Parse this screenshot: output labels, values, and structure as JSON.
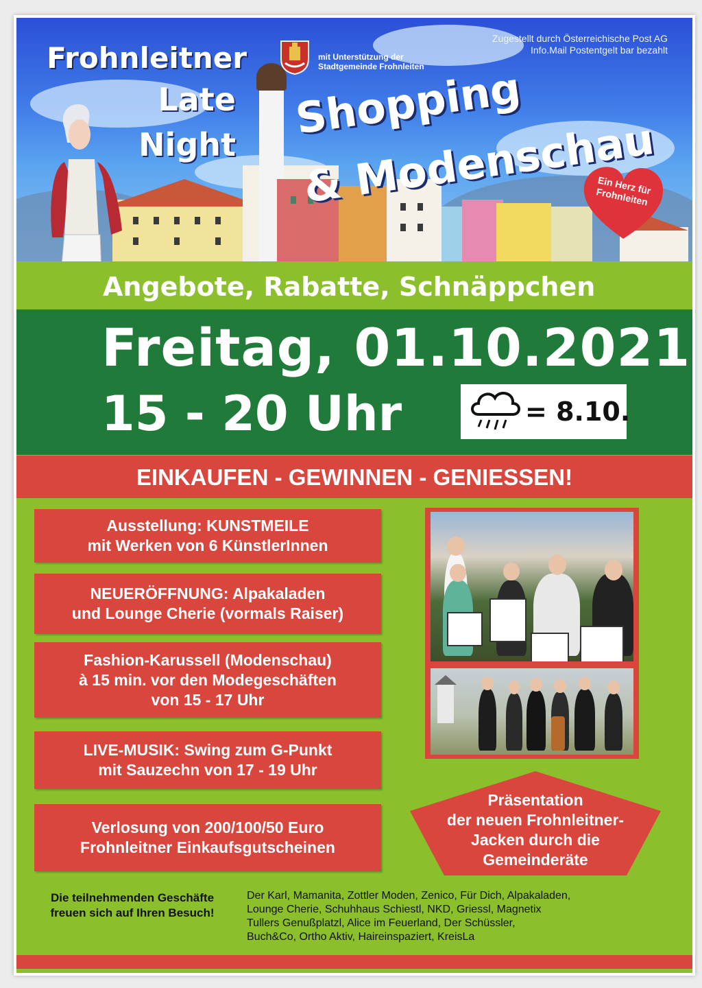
{
  "header": {
    "title_lines": [
      "Frohnleitner",
      "Late",
      "Night"
    ],
    "shopping": "Shopping",
    "modenschau": "& Modenschau",
    "support_line1": "mit Unterstützung der",
    "support_line2": "Stadtgemeinde Frohnleiten",
    "post_line1": "Zugestellt durch Österreichische Post AG",
    "post_line2": "Info.Mail Postentgelt bar bezahlt",
    "heart_line1": "Ein Herz für",
    "heart_line2": "Frohnleiten"
  },
  "event": {
    "offers": "Angebote, Rabatte, Schnäppchen",
    "date": "Freitag, 01.10.2021",
    "time": "15 - 20 Uhr",
    "rain_date": "= 8.10.",
    "slogan": "EINKAUFEN - GEWINNEN - GENIESSEN!"
  },
  "program": [
    {
      "line1": "Ausstellung: KUNSTMEILE",
      "line2": "mit Werken von 6 KünstlerInnen",
      "line3": ""
    },
    {
      "line1": "NEUERÖFFNUNG: Alpakaladen",
      "line2": "und Lounge Cherie (vormals Raiser)",
      "line3": ""
    },
    {
      "line1": "Fashion-Karussell (Modenschau)",
      "line2": "à 15 min. vor den Modegeschäften",
      "line3": "von 15 - 17 Uhr"
    },
    {
      "line1": "LIVE-MUSIK: Swing zum G-Punkt",
      "line2": "mit Sauzechn von 17 - 19 Uhr",
      "line3": ""
    },
    {
      "line1": "Verlosung von 200/100/50 Euro",
      "line2": "Frohnleitner Einkaufsgutscheinen",
      "line3": ""
    }
  ],
  "presentation": {
    "line1": "Präsentation",
    "line2": "der neuen Frohnleitner-",
    "line3": "Jacken durch die",
    "line4": "Gemeinderäte"
  },
  "shops": {
    "title_line1": "Die teilnehmenden Geschäfte",
    "title_line2": "freuen sich auf Ihren Besuch!",
    "list_line1": "Der Karl, Mamanita, Zottler Moden, Zenico, Für Dich, Alpakaladen,",
    "list_line2": "Lounge Cherie, Schuhhaus Schiestl, NKD, Griessl, Magnetix",
    "list_line3": "Tullers Genußplatzl, Alice im Feuerland, Der Schüssler,",
    "list_line4": "Buch&Co, Ortho Aktiv, Haireinspaziert, KreisLa"
  },
  "icons": [
    "crest-icon",
    "rain-cloud-icon",
    "heart-icon"
  ],
  "colors": {
    "green_light": "#8cbf2c",
    "green_dark": "#207a3a",
    "red": "#d8463e",
    "sky": "#3f7ae8"
  }
}
